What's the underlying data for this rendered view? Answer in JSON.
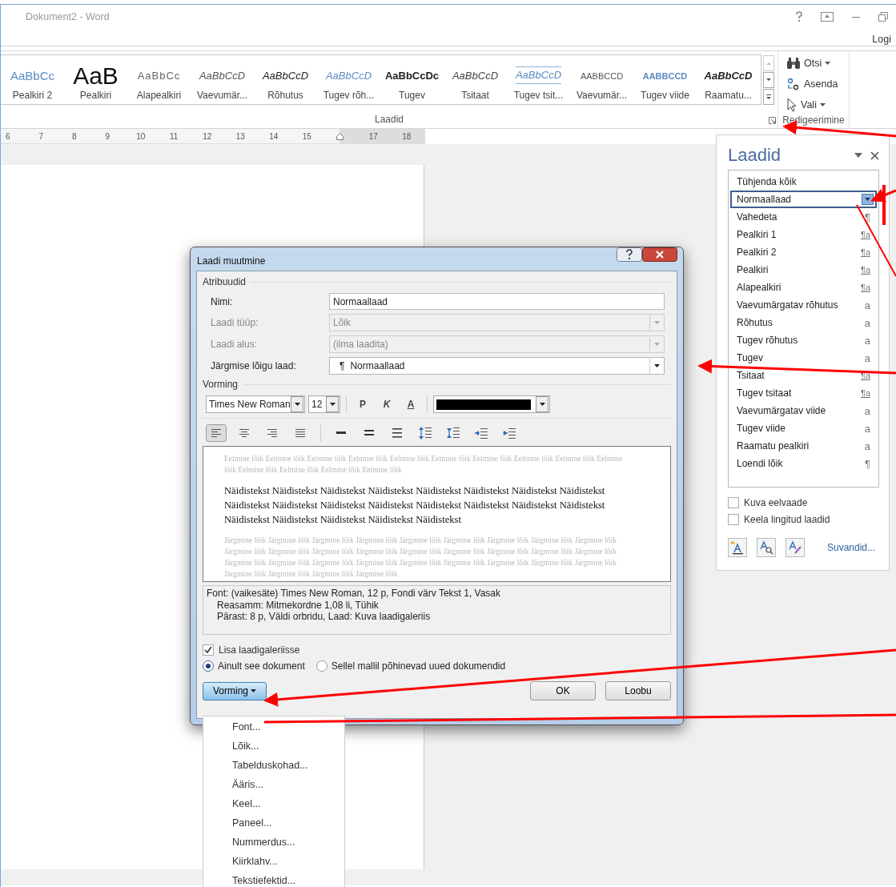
{
  "window": {
    "title": "Dokument2 - Word",
    "account": "Logi"
  },
  "ribbon": {
    "styles_gallery": {
      "group_label": "Laadid",
      "items": [
        {
          "preview": "AaBbCc",
          "label": "Pealkiri 2",
          "kind": "heading2"
        },
        {
          "preview": "AaB",
          "label": "Pealkiri",
          "kind": "title"
        },
        {
          "preview": "AaBbCc",
          "label": "Alapealkiri",
          "kind": "subtitle"
        },
        {
          "preview": "AaBbCcD",
          "label": "Vaevumär...",
          "kind": "subtle_emphasis"
        },
        {
          "preview": "AaBbCcD",
          "label": "Rõhutus",
          "kind": "emphasis"
        },
        {
          "preview": "AaBbCcD",
          "label": "Tugev rõh...",
          "kind": "intense_emphasis"
        },
        {
          "preview": "AaBbCcDc",
          "label": "Tugev",
          "kind": "strong"
        },
        {
          "preview": "AaBbCcD",
          "label": "Tsitaat",
          "kind": "quote"
        },
        {
          "preview": "AaBbCcD",
          "label": "Tugev tsit...",
          "kind": "intense_quote"
        },
        {
          "preview": "AABBCCD",
          "label": "Vaevumär...",
          "kind": "subtle_reference"
        },
        {
          "preview": "AABBCCD",
          "label": "Tugev viide",
          "kind": "intense_reference"
        },
        {
          "preview": "AaBbCcD",
          "label": "Raamatu...",
          "kind": "book_title"
        }
      ]
    },
    "editing": {
      "group_label": "Redigeerimine",
      "items": [
        {
          "label": "Otsi",
          "kind": "find"
        },
        {
          "label": "Asenda",
          "kind": "replace"
        },
        {
          "label": "Vali",
          "kind": "select"
        }
      ]
    }
  },
  "ruler": [
    {
      "kind": "number",
      "label": "6"
    },
    {
      "kind": "number",
      "label": "7"
    },
    {
      "kind": "number",
      "label": "8"
    },
    {
      "kind": "number",
      "label": "9"
    },
    {
      "kind": "number",
      "label": "10"
    },
    {
      "kind": "number",
      "label": "11"
    },
    {
      "kind": "number",
      "label": "12"
    },
    {
      "kind": "number",
      "label": "13"
    },
    {
      "kind": "number",
      "label": "14"
    },
    {
      "kind": "number",
      "label": "15"
    },
    {
      "kind": "indent_marker"
    },
    {
      "kind": "number",
      "label": "17"
    },
    {
      "kind": "number",
      "label": "18"
    }
  ],
  "styles_pane": {
    "title": "Laadid",
    "items": [
      {
        "name": "Tühjenda kõik",
        "selected": false
      },
      {
        "name": "Normaallaad",
        "selected": true
      },
      {
        "name": "Vahedeta",
        "marker": "¶",
        "selected": false
      },
      {
        "name": "Pealkiri 1",
        "marker": "¶a",
        "selected": false
      },
      {
        "name": "Pealkiri 2",
        "marker": "¶a",
        "selected": false
      },
      {
        "name": "Pealkiri",
        "marker": "¶a",
        "selected": false
      },
      {
        "name": "Alapealkiri",
        "marker": "¶a",
        "selected": false
      },
      {
        "name": "Vaevumärgatav rõhutus",
        "marker": "a",
        "selected": false
      },
      {
        "name": "Rõhutus",
        "marker": "a",
        "selected": false
      },
      {
        "name": "Tugev rõhutus",
        "marker": "a",
        "selected": false
      },
      {
        "name": "Tugev",
        "marker": "a",
        "selected": false
      },
      {
        "name": "Tsitaat",
        "marker": "¶a",
        "selected": false
      },
      {
        "name": "Tugev tsitaat",
        "marker": "¶a",
        "selected": false
      },
      {
        "name": "Vaevumärgatav viide",
        "marker": "a",
        "selected": false
      },
      {
        "name": "Tugev viide",
        "marker": "a",
        "selected": false
      },
      {
        "name": "Raamatu pealkiri",
        "marker": "a",
        "selected": false
      },
      {
        "name": "Loendi lõik",
        "marker": "¶",
        "selected": false
      }
    ],
    "options": [
      {
        "label": "Kuva eelvaade",
        "checked": false
      },
      {
        "label": "Keela lingitud laadid",
        "checked": false
      }
    ],
    "link": "Suvandid..."
  },
  "dialog": {
    "title": "Laadi muutmine",
    "attributes": {
      "heading": "Atribuudid",
      "fields": [
        {
          "label": "Nimi:",
          "value": "Normaallaad",
          "kind": "text",
          "disabled": false
        },
        {
          "label": "Laadi tüüp:",
          "value": "Lõik",
          "kind": "dropdown",
          "disabled": true
        },
        {
          "label": "Laadi alus:",
          "value": "(ilma laadita)",
          "kind": "dropdown",
          "disabled": true
        },
        {
          "label": "Järgmise lõigu laad:",
          "marker": "¶",
          "value": "Normaallaad",
          "kind": "dropdown",
          "disabled": false
        }
      ]
    },
    "formatting": {
      "heading": "Vorming",
      "font": "Times New Roman",
      "size": "12",
      "style_buttons": [
        "P",
        "K",
        "A"
      ],
      "alignment": [
        {
          "kind": "align_left",
          "selected": true
        },
        {
          "kind": "align_center",
          "selected": false
        },
        {
          "kind": "align_right",
          "selected": false
        },
        {
          "kind": "justify",
          "selected": false
        }
      ],
      "spacing": [
        {
          "kind": "single"
        },
        {
          "kind": "one_and_half"
        },
        {
          "kind": "double"
        },
        {
          "kind": "space_increase"
        },
        {
          "kind": "space_decrease"
        },
        {
          "kind": "indent_decrease"
        },
        {
          "kind": "indent_increase"
        }
      ]
    },
    "preview": {
      "previous": "Eelmine lõik Eelmine lõik Eelmine lõik Eelmine lõik Eelmine lõik Eelmine lõik Eelmine lõik Eelmine lõik Eelmine lõik Eelmine lõik Eelmine lõik Eelmine lõik Eelmine lõik Eelmine lõik",
      "sample": "Näidistekst Näidistekst Näidistekst Näidistekst Näidistekst Näidistekst Näidistekst Näidistekst Näidistekst Näidistekst Näidistekst Näidistekst Näidistekst Näidistekst Näidistekst Näidistekst Näidistekst Näidistekst Näidistekst Näidistekst Näidistekst",
      "next": "Järgmine lõik Järgmine lõik Järgmine lõik Järgmine lõik Järgmine lõik Järgmine lõik Järgmine lõik Järgmine lõik Järgmine lõik Järgmine lõik Järgmine lõik Järgmine lõik Järgmine lõik Järgmine lõik Järgmine lõik Järgmine lõik Järgmine lõik Järgmine lõik Järgmine lõik Järgmine lõik Järgmine lõik Järgmine lõik Järgmine lõik Järgmine lõik Järgmine lõik Järgmine lõik Järgmine lõik Järgmine lõik Järgmine lõik Järgmine lõik Järgmine lõik"
    },
    "description": [
      "Font: (vaikesäte) Times New Roman, 12 p, Fondi värv Tekst 1, Vasak",
      "Reasamm:  Mitmekordne 1,08 li, Tühik",
      "Pärast:  8 p, Väldi orbridu, Laad: Kuva laadigaleriis"
    ],
    "add_to_gallery": {
      "label": "Lisa laadigaleriisse",
      "checked": true
    },
    "scope": [
      {
        "label": "Ainult see dokument",
        "selected": true
      },
      {
        "label": "Sellel mallil põhinevad uued dokumendid",
        "selected": false
      }
    ],
    "format_button": {
      "label": "Vorming",
      "expanded": true
    },
    "buttons": [
      "OK",
      "Loobu"
    ]
  },
  "format_menu": [
    "Font...",
    "Lõik...",
    "Tabelduskohad...",
    "Ääris...",
    "Keel...",
    "Paneel...",
    "Nummerdus...",
    "Kiirklahv...",
    "Tekstiefektid..."
  ]
}
